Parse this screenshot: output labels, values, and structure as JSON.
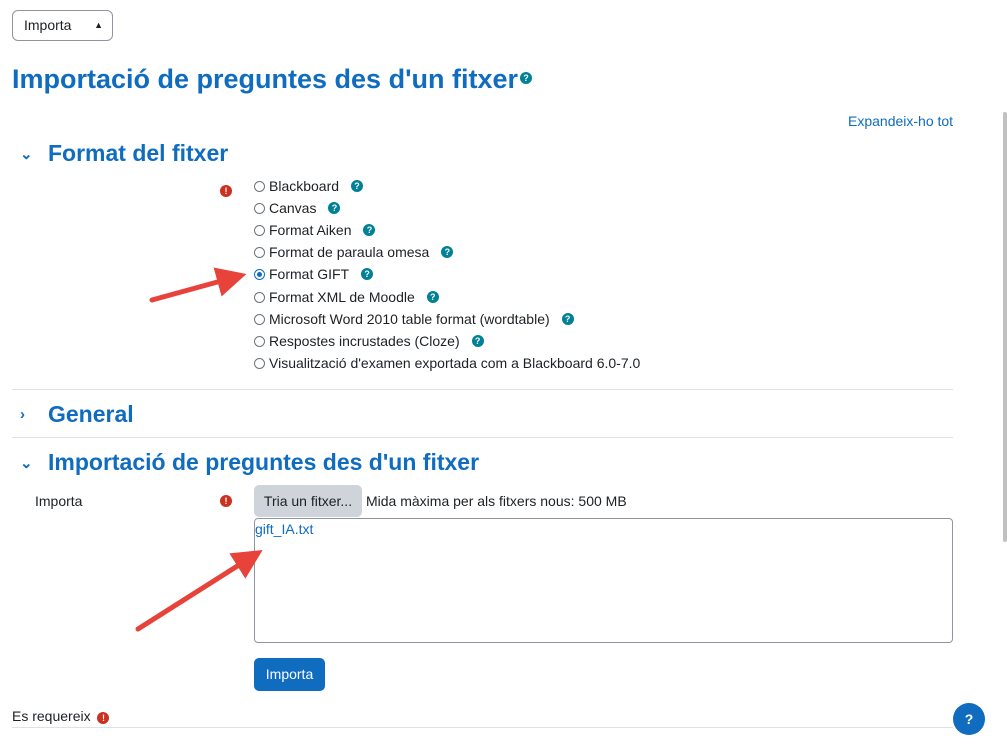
{
  "header": {
    "action_select": "Importa",
    "title": "Importació de preguntes des d'un fitxer",
    "expand_all": "Expandeix-ho tot"
  },
  "sections": {
    "file_format": {
      "title": "Format del fitxer",
      "options": [
        {
          "label": "Blackboard",
          "checked": false,
          "help": true
        },
        {
          "label": "Canvas",
          "checked": false,
          "help": true
        },
        {
          "label": "Format Aiken",
          "checked": false,
          "help": true
        },
        {
          "label": "Format de paraula omesa",
          "checked": false,
          "help": true
        },
        {
          "label": "Format GIFT",
          "checked": true,
          "help": true
        },
        {
          "label": "Format XML de Moodle",
          "checked": false,
          "help": true
        },
        {
          "label": "Microsoft Word 2010 table format (wordtable)",
          "checked": false,
          "help": true
        },
        {
          "label": "Respostes incrustades (Cloze)",
          "checked": false,
          "help": true
        },
        {
          "label": "Visualització d'examen exportada com a Blackboard 6.0-7.0",
          "checked": false,
          "help": false
        }
      ]
    },
    "general": {
      "title": "General"
    },
    "import_file": {
      "title": "Importació de preguntes des d'un fitxer",
      "field_label": "Importa",
      "choose_button": "Tria un fitxer...",
      "max_size": "Mida màxima per als fitxers nous: 500 MB",
      "file_name": "gift_IA.txt",
      "import_button": "Importa"
    }
  },
  "footer": {
    "required_note": "Es requereix"
  },
  "icons": {
    "help": "question-circle-icon",
    "required": "exclamation-circle-icon",
    "expanded": "chevron-down-icon",
    "collapsed": "chevron-right-icon"
  },
  "colors": {
    "primary": "#0f6cbf",
    "help": "#008196",
    "required": "#ca3120",
    "annotation_arrow": "#e8433a"
  }
}
